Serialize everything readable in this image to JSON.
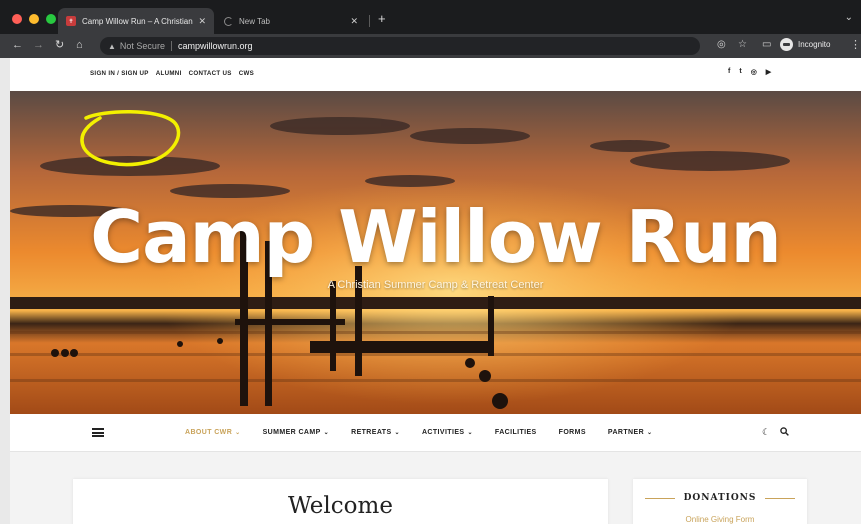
{
  "browser": {
    "tabs": [
      {
        "title": "Camp Willow Run – A Christian",
        "active": true
      },
      {
        "title": "New Tab",
        "active": false
      }
    ],
    "new_tab": "+",
    "address": {
      "security_label": "Not Secure",
      "url": "campwillowrun.org"
    },
    "profile_label": "Incognito"
  },
  "site": {
    "top_links": [
      "SIGN IN / SIGN UP",
      "ALUMNI",
      "CONTACT US",
      "CWS"
    ],
    "social_icons": [
      "facebook-icon",
      "twitter-icon",
      "instagram-icon",
      "youtube-icon"
    ],
    "hero": {
      "title": "Camp Willow Run",
      "tagline": "A Christian Summer Camp & Retreat Center"
    },
    "nav": [
      {
        "label": "ABOUT CWR",
        "has_caret": true,
        "active": true
      },
      {
        "label": "SUMMER CAMP",
        "has_caret": true,
        "active": false
      },
      {
        "label": "RETREATS",
        "has_caret": true,
        "active": false
      },
      {
        "label": "ACTIVITIES",
        "has_caret": true,
        "active": false
      },
      {
        "label": "FACILITIES",
        "has_caret": false,
        "active": false
      },
      {
        "label": "FORMS",
        "has_caret": false,
        "active": false
      },
      {
        "label": "PARTNER",
        "has_caret": true,
        "active": false
      }
    ],
    "welcome_heading": "Welcome",
    "sidebar": {
      "heading": "DONATIONS",
      "link": "Online Giving Form"
    }
  },
  "colors": {
    "accent_gold": "#c9a35a",
    "annotation_yellow": "#f3f000",
    "chrome_dark": "#1b1c1e"
  }
}
